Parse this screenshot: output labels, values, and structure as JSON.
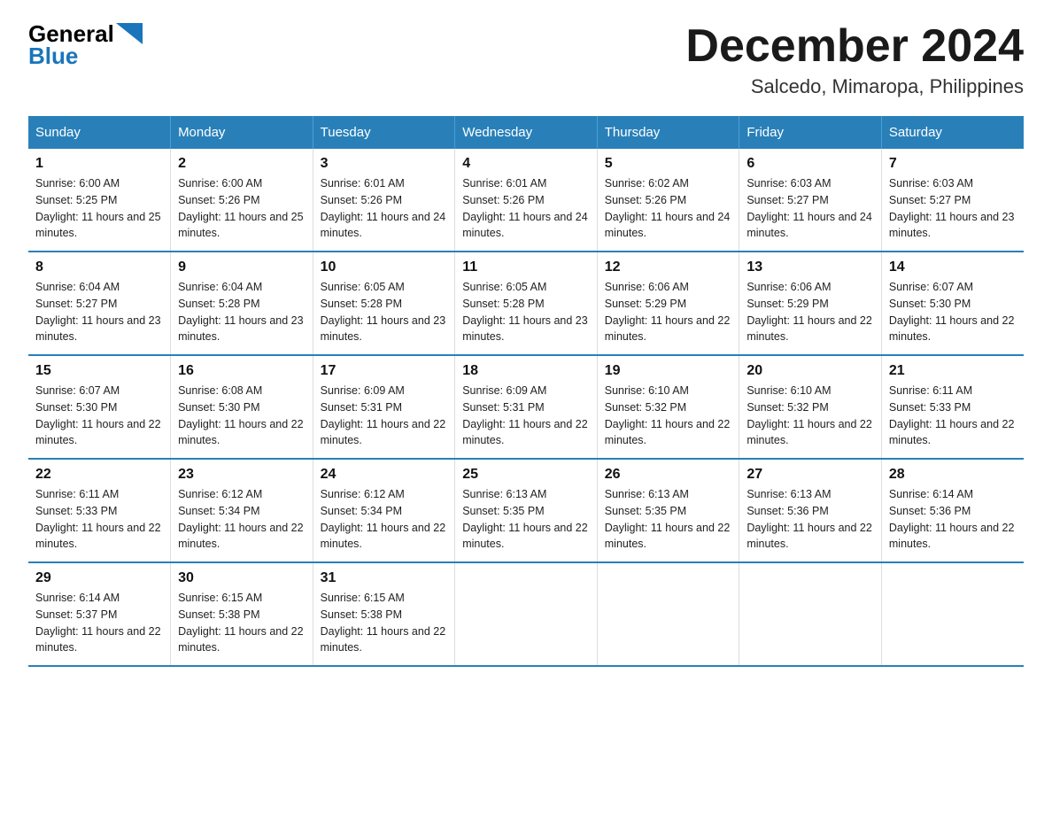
{
  "header": {
    "logo_general": "General",
    "logo_blue": "Blue",
    "month_title": "December 2024",
    "location": "Salcedo, Mimaropa, Philippines"
  },
  "weekdays": [
    "Sunday",
    "Monday",
    "Tuesday",
    "Wednesday",
    "Thursday",
    "Friday",
    "Saturday"
  ],
  "weeks": [
    [
      {
        "day": "1",
        "sunrise": "6:00 AM",
        "sunset": "5:25 PM",
        "daylight": "11 hours and 25 minutes."
      },
      {
        "day": "2",
        "sunrise": "6:00 AM",
        "sunset": "5:26 PM",
        "daylight": "11 hours and 25 minutes."
      },
      {
        "day": "3",
        "sunrise": "6:01 AM",
        "sunset": "5:26 PM",
        "daylight": "11 hours and 24 minutes."
      },
      {
        "day": "4",
        "sunrise": "6:01 AM",
        "sunset": "5:26 PM",
        "daylight": "11 hours and 24 minutes."
      },
      {
        "day": "5",
        "sunrise": "6:02 AM",
        "sunset": "5:26 PM",
        "daylight": "11 hours and 24 minutes."
      },
      {
        "day": "6",
        "sunrise": "6:03 AM",
        "sunset": "5:27 PM",
        "daylight": "11 hours and 24 minutes."
      },
      {
        "day": "7",
        "sunrise": "6:03 AM",
        "sunset": "5:27 PM",
        "daylight": "11 hours and 23 minutes."
      }
    ],
    [
      {
        "day": "8",
        "sunrise": "6:04 AM",
        "sunset": "5:27 PM",
        "daylight": "11 hours and 23 minutes."
      },
      {
        "day": "9",
        "sunrise": "6:04 AM",
        "sunset": "5:28 PM",
        "daylight": "11 hours and 23 minutes."
      },
      {
        "day": "10",
        "sunrise": "6:05 AM",
        "sunset": "5:28 PM",
        "daylight": "11 hours and 23 minutes."
      },
      {
        "day": "11",
        "sunrise": "6:05 AM",
        "sunset": "5:28 PM",
        "daylight": "11 hours and 23 minutes."
      },
      {
        "day": "12",
        "sunrise": "6:06 AM",
        "sunset": "5:29 PM",
        "daylight": "11 hours and 22 minutes."
      },
      {
        "day": "13",
        "sunrise": "6:06 AM",
        "sunset": "5:29 PM",
        "daylight": "11 hours and 22 minutes."
      },
      {
        "day": "14",
        "sunrise": "6:07 AM",
        "sunset": "5:30 PM",
        "daylight": "11 hours and 22 minutes."
      }
    ],
    [
      {
        "day": "15",
        "sunrise": "6:07 AM",
        "sunset": "5:30 PM",
        "daylight": "11 hours and 22 minutes."
      },
      {
        "day": "16",
        "sunrise": "6:08 AM",
        "sunset": "5:30 PM",
        "daylight": "11 hours and 22 minutes."
      },
      {
        "day": "17",
        "sunrise": "6:09 AM",
        "sunset": "5:31 PM",
        "daylight": "11 hours and 22 minutes."
      },
      {
        "day": "18",
        "sunrise": "6:09 AM",
        "sunset": "5:31 PM",
        "daylight": "11 hours and 22 minutes."
      },
      {
        "day": "19",
        "sunrise": "6:10 AM",
        "sunset": "5:32 PM",
        "daylight": "11 hours and 22 minutes."
      },
      {
        "day": "20",
        "sunrise": "6:10 AM",
        "sunset": "5:32 PM",
        "daylight": "11 hours and 22 minutes."
      },
      {
        "day": "21",
        "sunrise": "6:11 AM",
        "sunset": "5:33 PM",
        "daylight": "11 hours and 22 minutes."
      }
    ],
    [
      {
        "day": "22",
        "sunrise": "6:11 AM",
        "sunset": "5:33 PM",
        "daylight": "11 hours and 22 minutes."
      },
      {
        "day": "23",
        "sunrise": "6:12 AM",
        "sunset": "5:34 PM",
        "daylight": "11 hours and 22 minutes."
      },
      {
        "day": "24",
        "sunrise": "6:12 AM",
        "sunset": "5:34 PM",
        "daylight": "11 hours and 22 minutes."
      },
      {
        "day": "25",
        "sunrise": "6:13 AM",
        "sunset": "5:35 PM",
        "daylight": "11 hours and 22 minutes."
      },
      {
        "day": "26",
        "sunrise": "6:13 AM",
        "sunset": "5:35 PM",
        "daylight": "11 hours and 22 minutes."
      },
      {
        "day": "27",
        "sunrise": "6:13 AM",
        "sunset": "5:36 PM",
        "daylight": "11 hours and 22 minutes."
      },
      {
        "day": "28",
        "sunrise": "6:14 AM",
        "sunset": "5:36 PM",
        "daylight": "11 hours and 22 minutes."
      }
    ],
    [
      {
        "day": "29",
        "sunrise": "6:14 AM",
        "sunset": "5:37 PM",
        "daylight": "11 hours and 22 minutes."
      },
      {
        "day": "30",
        "sunrise": "6:15 AM",
        "sunset": "5:38 PM",
        "daylight": "11 hours and 22 minutes."
      },
      {
        "day": "31",
        "sunrise": "6:15 AM",
        "sunset": "5:38 PM",
        "daylight": "11 hours and 22 minutes."
      },
      null,
      null,
      null,
      null
    ]
  ]
}
